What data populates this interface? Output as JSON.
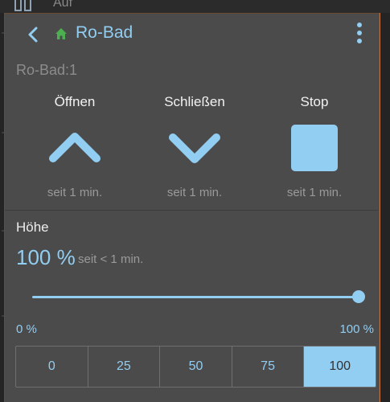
{
  "background": {
    "label": "Auf"
  },
  "header": {
    "title": "Ro-Bad"
  },
  "subtitle": "Ro-Bad:1",
  "controls": [
    {
      "label": "Öffnen",
      "since": "seit 1 min.",
      "icon": "chevron-up-icon"
    },
    {
      "label": "Schließen",
      "since": "seit 1 min.",
      "icon": "chevron-down-icon"
    },
    {
      "label": "Stop",
      "since": "seit 1 min.",
      "icon": "stop-square-icon"
    }
  ],
  "hoehe": {
    "label": "Höhe",
    "value": "100 %",
    "since": "seit < 1 min.",
    "level_percent": 100
  },
  "range": {
    "min": "0 %",
    "max": "100 %"
  },
  "presets": [
    "0",
    "25",
    "50",
    "75",
    "100"
  ],
  "active_preset": "100",
  "colors": {
    "accent": "#92cdf2",
    "panel": "#4b4b4b",
    "home_icon": "#4caf50"
  }
}
